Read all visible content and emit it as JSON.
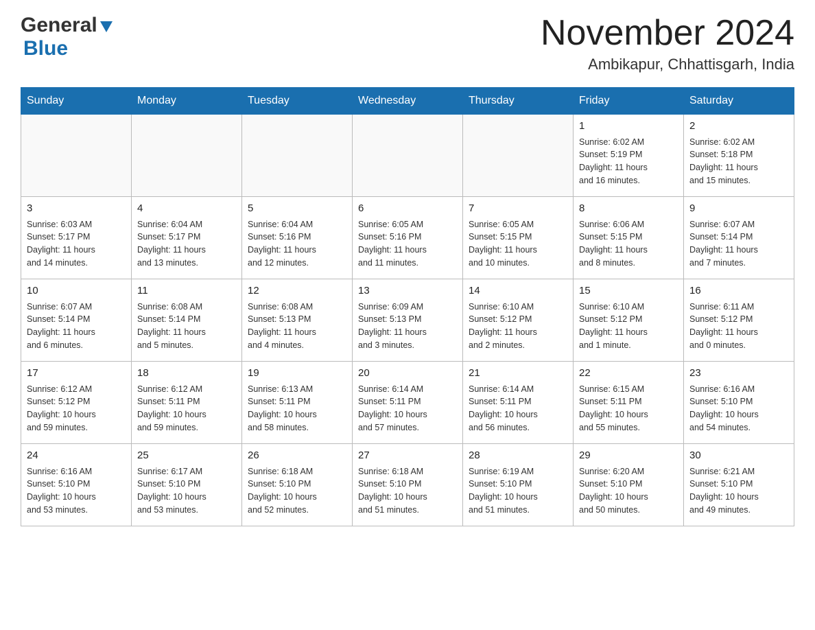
{
  "header": {
    "logo_general": "General",
    "logo_blue": "Blue",
    "main_title": "November 2024",
    "subtitle": "Ambikapur, Chhattisgarh, India"
  },
  "days_of_week": [
    "Sunday",
    "Monday",
    "Tuesday",
    "Wednesday",
    "Thursday",
    "Friday",
    "Saturday"
  ],
  "weeks": [
    [
      {
        "day": "",
        "info": ""
      },
      {
        "day": "",
        "info": ""
      },
      {
        "day": "",
        "info": ""
      },
      {
        "day": "",
        "info": ""
      },
      {
        "day": "",
        "info": ""
      },
      {
        "day": "1",
        "info": "Sunrise: 6:02 AM\nSunset: 5:19 PM\nDaylight: 11 hours\nand 16 minutes."
      },
      {
        "day": "2",
        "info": "Sunrise: 6:02 AM\nSunset: 5:18 PM\nDaylight: 11 hours\nand 15 minutes."
      }
    ],
    [
      {
        "day": "3",
        "info": "Sunrise: 6:03 AM\nSunset: 5:17 PM\nDaylight: 11 hours\nand 14 minutes."
      },
      {
        "day": "4",
        "info": "Sunrise: 6:04 AM\nSunset: 5:17 PM\nDaylight: 11 hours\nand 13 minutes."
      },
      {
        "day": "5",
        "info": "Sunrise: 6:04 AM\nSunset: 5:16 PM\nDaylight: 11 hours\nand 12 minutes."
      },
      {
        "day": "6",
        "info": "Sunrise: 6:05 AM\nSunset: 5:16 PM\nDaylight: 11 hours\nand 11 minutes."
      },
      {
        "day": "7",
        "info": "Sunrise: 6:05 AM\nSunset: 5:15 PM\nDaylight: 11 hours\nand 10 minutes."
      },
      {
        "day": "8",
        "info": "Sunrise: 6:06 AM\nSunset: 5:15 PM\nDaylight: 11 hours\nand 8 minutes."
      },
      {
        "day": "9",
        "info": "Sunrise: 6:07 AM\nSunset: 5:14 PM\nDaylight: 11 hours\nand 7 minutes."
      }
    ],
    [
      {
        "day": "10",
        "info": "Sunrise: 6:07 AM\nSunset: 5:14 PM\nDaylight: 11 hours\nand 6 minutes."
      },
      {
        "day": "11",
        "info": "Sunrise: 6:08 AM\nSunset: 5:14 PM\nDaylight: 11 hours\nand 5 minutes."
      },
      {
        "day": "12",
        "info": "Sunrise: 6:08 AM\nSunset: 5:13 PM\nDaylight: 11 hours\nand 4 minutes."
      },
      {
        "day": "13",
        "info": "Sunrise: 6:09 AM\nSunset: 5:13 PM\nDaylight: 11 hours\nand 3 minutes."
      },
      {
        "day": "14",
        "info": "Sunrise: 6:10 AM\nSunset: 5:12 PM\nDaylight: 11 hours\nand 2 minutes."
      },
      {
        "day": "15",
        "info": "Sunrise: 6:10 AM\nSunset: 5:12 PM\nDaylight: 11 hours\nand 1 minute."
      },
      {
        "day": "16",
        "info": "Sunrise: 6:11 AM\nSunset: 5:12 PM\nDaylight: 11 hours\nand 0 minutes."
      }
    ],
    [
      {
        "day": "17",
        "info": "Sunrise: 6:12 AM\nSunset: 5:12 PM\nDaylight: 10 hours\nand 59 minutes."
      },
      {
        "day": "18",
        "info": "Sunrise: 6:12 AM\nSunset: 5:11 PM\nDaylight: 10 hours\nand 59 minutes."
      },
      {
        "day": "19",
        "info": "Sunrise: 6:13 AM\nSunset: 5:11 PM\nDaylight: 10 hours\nand 58 minutes."
      },
      {
        "day": "20",
        "info": "Sunrise: 6:14 AM\nSunset: 5:11 PM\nDaylight: 10 hours\nand 57 minutes."
      },
      {
        "day": "21",
        "info": "Sunrise: 6:14 AM\nSunset: 5:11 PM\nDaylight: 10 hours\nand 56 minutes."
      },
      {
        "day": "22",
        "info": "Sunrise: 6:15 AM\nSunset: 5:11 PM\nDaylight: 10 hours\nand 55 minutes."
      },
      {
        "day": "23",
        "info": "Sunrise: 6:16 AM\nSunset: 5:10 PM\nDaylight: 10 hours\nand 54 minutes."
      }
    ],
    [
      {
        "day": "24",
        "info": "Sunrise: 6:16 AM\nSunset: 5:10 PM\nDaylight: 10 hours\nand 53 minutes."
      },
      {
        "day": "25",
        "info": "Sunrise: 6:17 AM\nSunset: 5:10 PM\nDaylight: 10 hours\nand 53 minutes."
      },
      {
        "day": "26",
        "info": "Sunrise: 6:18 AM\nSunset: 5:10 PM\nDaylight: 10 hours\nand 52 minutes."
      },
      {
        "day": "27",
        "info": "Sunrise: 6:18 AM\nSunset: 5:10 PM\nDaylight: 10 hours\nand 51 minutes."
      },
      {
        "day": "28",
        "info": "Sunrise: 6:19 AM\nSunset: 5:10 PM\nDaylight: 10 hours\nand 51 minutes."
      },
      {
        "day": "29",
        "info": "Sunrise: 6:20 AM\nSunset: 5:10 PM\nDaylight: 10 hours\nand 50 minutes."
      },
      {
        "day": "30",
        "info": "Sunrise: 6:21 AM\nSunset: 5:10 PM\nDaylight: 10 hours\nand 49 minutes."
      }
    ]
  ]
}
